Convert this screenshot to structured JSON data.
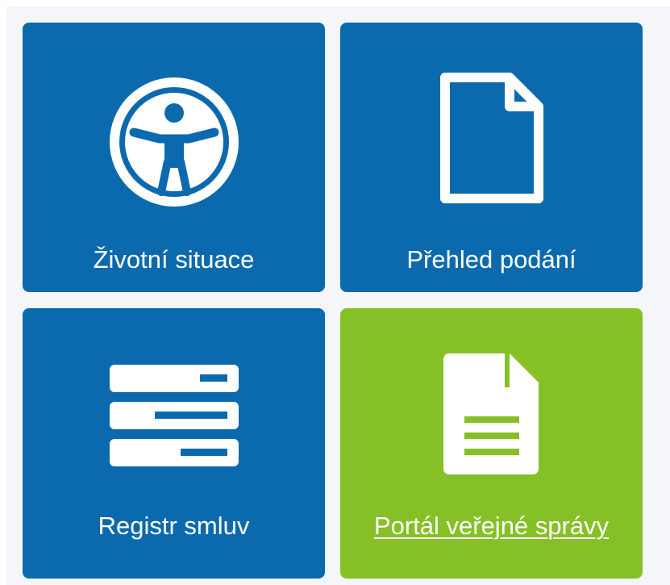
{
  "tiles": [
    {
      "label": "Životní situace",
      "icon": "accessibility-icon",
      "color": "#0b6aae"
    },
    {
      "label": "Přehled podání",
      "icon": "document-outline-icon",
      "color": "#0b6aae"
    },
    {
      "label": "Registr smluv",
      "icon": "registry-stack-icon",
      "color": "#0b6aae"
    },
    {
      "label": "Portál veřejné správy",
      "icon": "document-text-icon",
      "color": "#86c027"
    }
  ],
  "colors": {
    "background": "#f4f6f9",
    "tile_blue": "#0b6aae",
    "tile_green": "#86c027",
    "text": "#ffffff"
  }
}
